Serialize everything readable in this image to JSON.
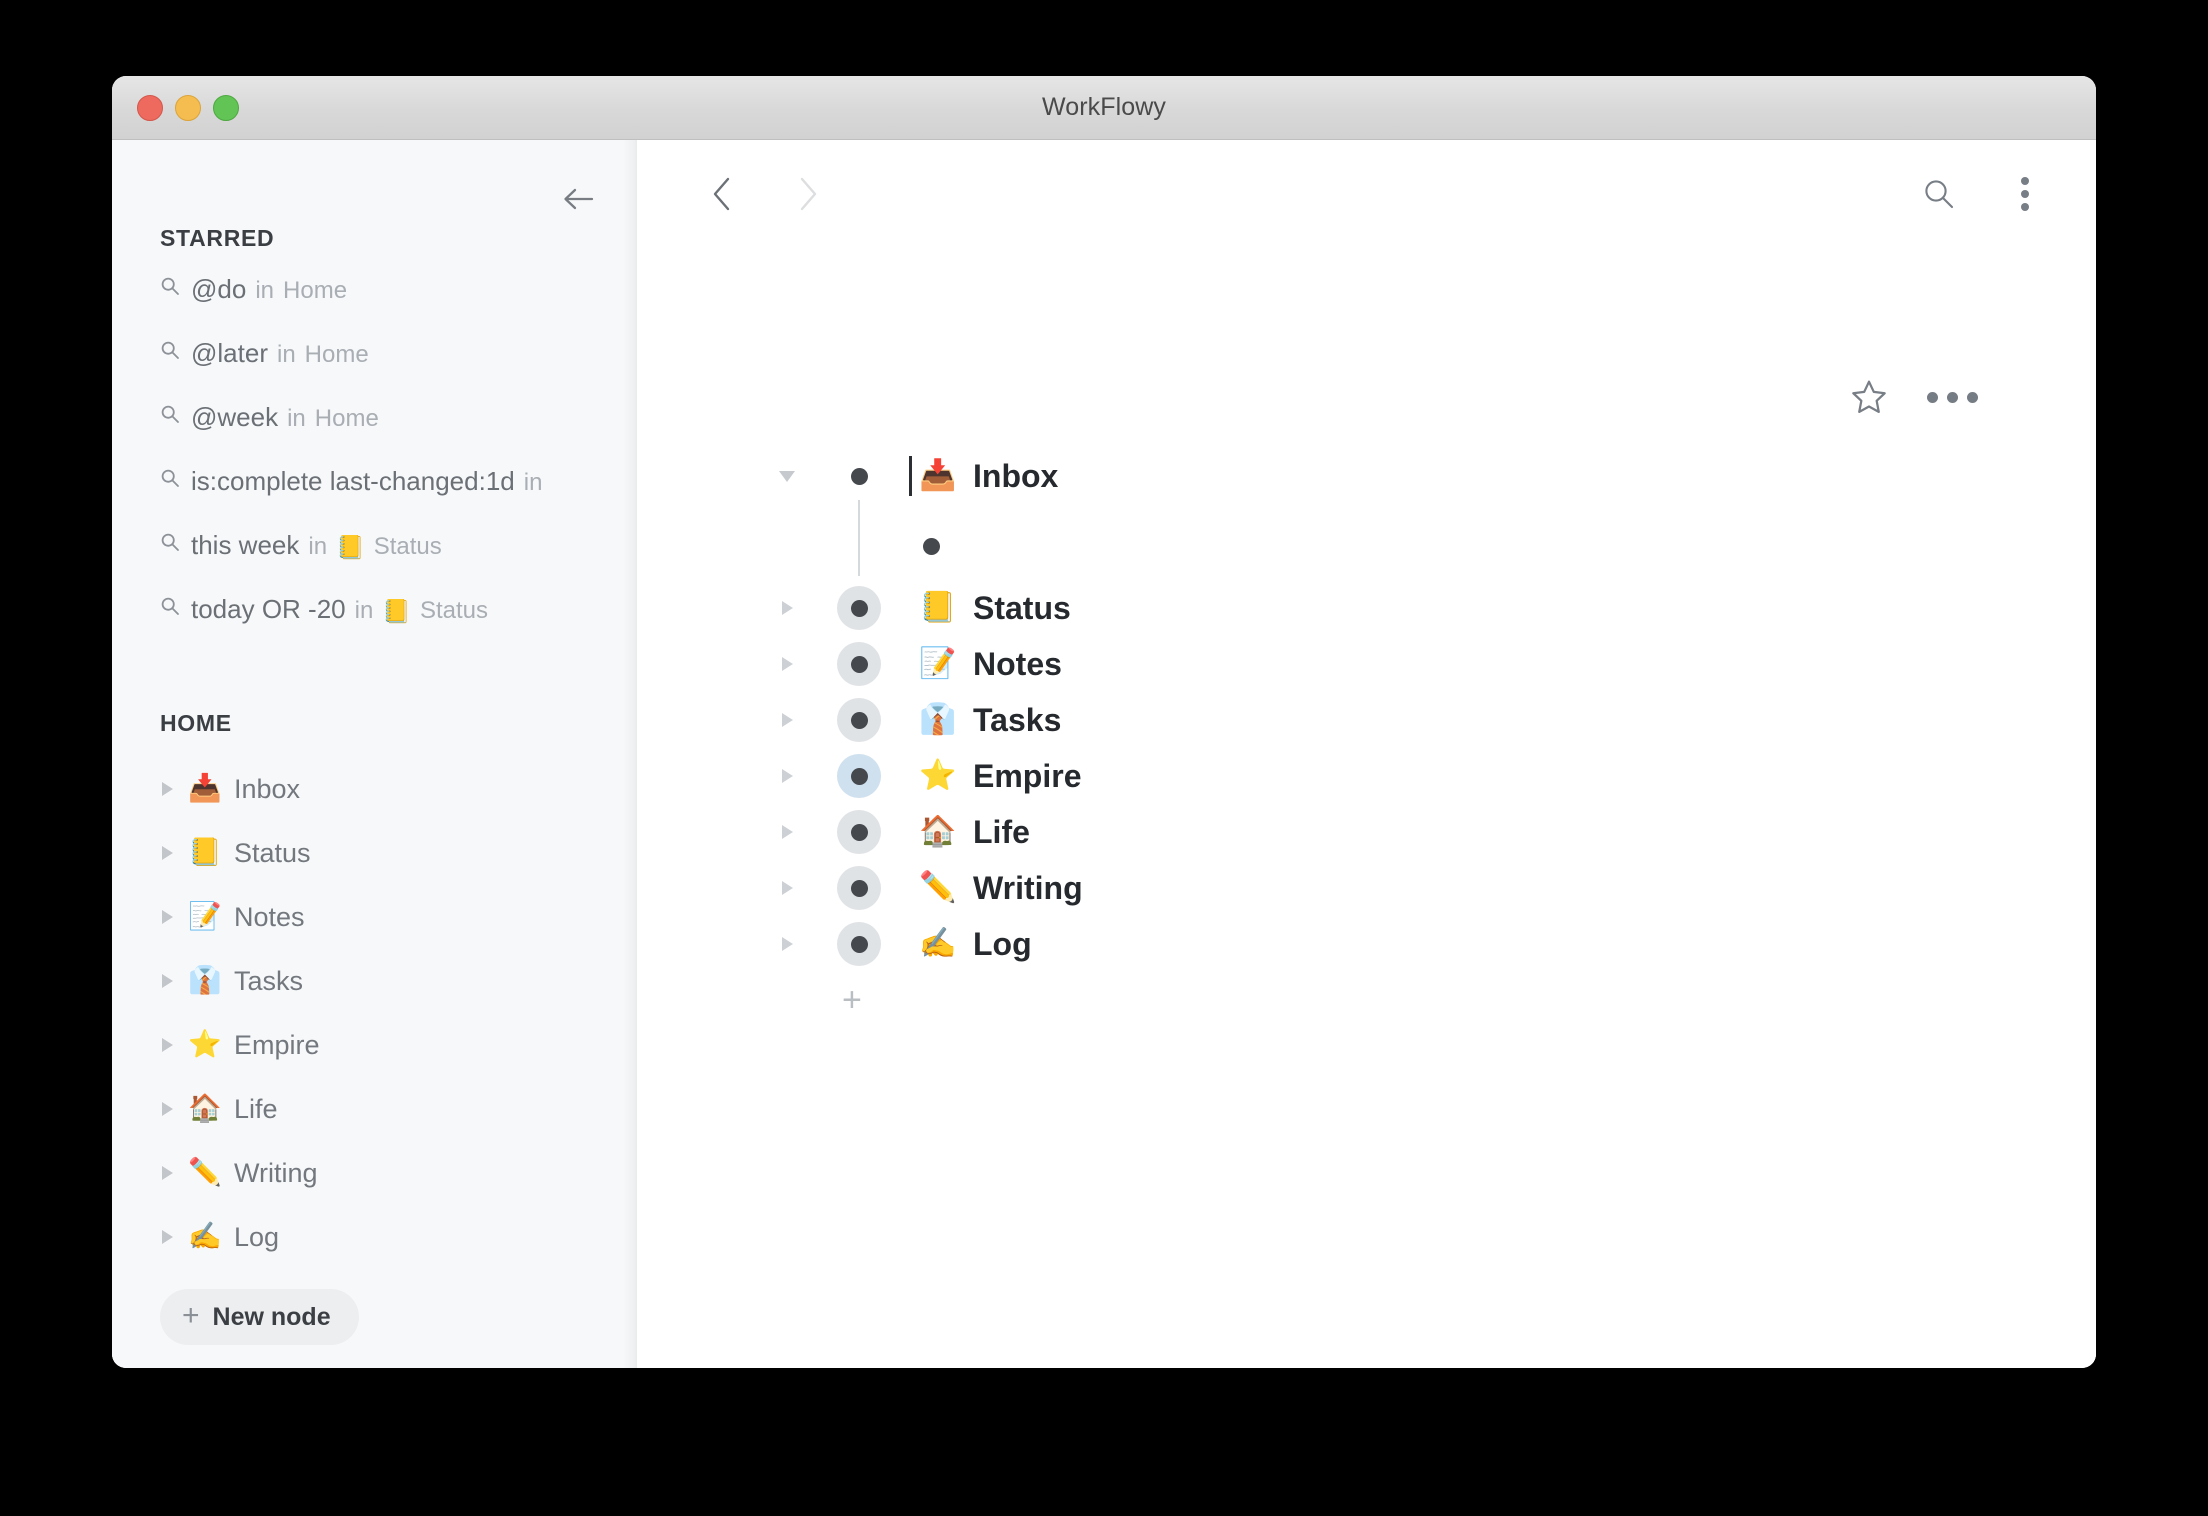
{
  "window": {
    "title": "WorkFlowy",
    "traffic_lights": [
      "close",
      "minimize",
      "zoom"
    ]
  },
  "sidebar": {
    "collapse_icon": "arrow-left-icon",
    "starred": {
      "heading": "STARRED",
      "items": [
        {
          "icon": "search-icon",
          "query": "@do",
          "in": "in",
          "scope_emoji": "",
          "scope": "Home"
        },
        {
          "icon": "search-icon",
          "query": "@later",
          "in": "in",
          "scope_emoji": "",
          "scope": "Home"
        },
        {
          "icon": "search-icon",
          "query": "@week",
          "in": "in",
          "scope_emoji": "",
          "scope": "Home"
        },
        {
          "icon": "search-icon",
          "query": "is:complete last-changed:1d",
          "in": "in",
          "scope_emoji": "",
          "scope": ""
        },
        {
          "icon": "search-icon",
          "query": "this week",
          "in": "in",
          "scope_emoji": "📒",
          "scope": "Status"
        },
        {
          "icon": "search-icon",
          "query": "today OR -20",
          "in": "in",
          "scope_emoji": "📒",
          "scope": "Status"
        }
      ]
    },
    "home": {
      "heading": "HOME",
      "items": [
        {
          "caret": "caret-right-icon",
          "emoji": "📥",
          "label": "Inbox"
        },
        {
          "caret": "caret-right-icon",
          "emoji": "📒",
          "label": "Status"
        },
        {
          "caret": "caret-right-icon",
          "emoji": "📝",
          "label": "Notes"
        },
        {
          "caret": "caret-right-icon",
          "emoji": "👔",
          "label": "Tasks"
        },
        {
          "caret": "caret-right-icon",
          "emoji": "⭐",
          "label": "Empire"
        },
        {
          "caret": "caret-right-icon",
          "emoji": "🏠",
          "label": "Life"
        },
        {
          "caret": "caret-right-icon",
          "emoji": "✏️",
          "label": "Writing"
        },
        {
          "caret": "caret-right-icon",
          "emoji": "✍️",
          "label": "Log"
        }
      ]
    },
    "new_node": {
      "plus": "+",
      "label": "New node"
    }
  },
  "main": {
    "toolbar": {
      "back_icon": "chevron-left-icon",
      "forward_icon": "chevron-right-icon",
      "search_icon": "search-icon",
      "menu_icon": "kebab-menu-icon"
    },
    "doc_actions": {
      "star_icon": "star-outline-icon",
      "more_icon": "ellipsis-icon"
    },
    "outline": {
      "rows": [
        {
          "expanded": true,
          "halo": "none",
          "emoji": "📥",
          "label": "Inbox",
          "has_caret_cursor": true
        },
        {
          "expanded": false,
          "halo": "none",
          "emoji": "",
          "label": "",
          "child": true
        },
        {
          "expanded": false,
          "halo": "gray",
          "emoji": "📒",
          "label": "Status"
        },
        {
          "expanded": false,
          "halo": "gray",
          "emoji": "📝",
          "label": "Notes"
        },
        {
          "expanded": false,
          "halo": "gray",
          "emoji": "👔",
          "label": "Tasks"
        },
        {
          "expanded": false,
          "halo": "blue",
          "emoji": "⭐",
          "label": "Empire"
        },
        {
          "expanded": false,
          "halo": "gray",
          "emoji": "🏠",
          "label": "Life"
        },
        {
          "expanded": false,
          "halo": "gray",
          "emoji": "✏️",
          "label": "Writing"
        },
        {
          "expanded": false,
          "halo": "gray",
          "emoji": "✍️",
          "label": "Log"
        }
      ],
      "add_row": "+"
    }
  },
  "colors": {
    "sidebar_bg": "#f7f8f9",
    "main_bg": "#ffffff",
    "titlebar_bg": "#d8d8d8",
    "text_primary": "#262a2e",
    "text_muted": "#73787e",
    "text_faint": "#a9aeb4",
    "bullet": "#45494e",
    "halo_gray": "#e0e3e6",
    "halo_blue": "#cfe0ee"
  }
}
